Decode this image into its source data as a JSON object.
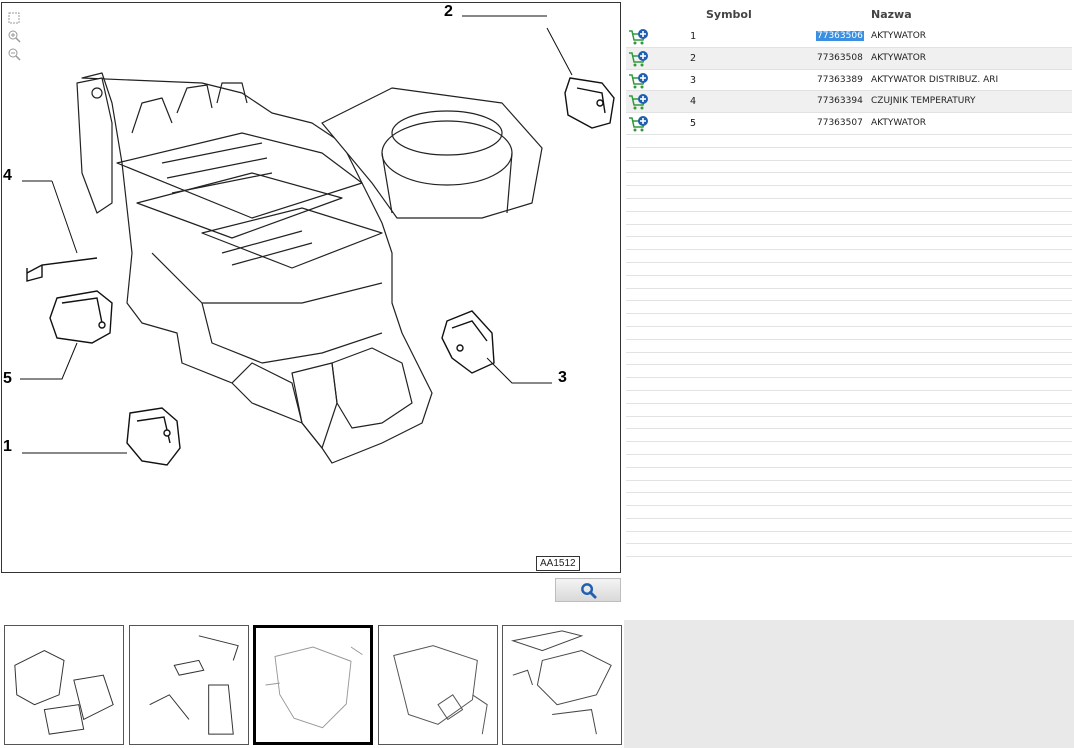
{
  "viewer": {
    "tools": [
      {
        "name": "fit-icon"
      },
      {
        "name": "zoom-in-icon"
      },
      {
        "name": "zoom-out-icon"
      }
    ],
    "callouts": [
      "1",
      "2",
      "3",
      "4",
      "5"
    ],
    "reference_code": "AA1512"
  },
  "search_button": {
    "icon": "search-icon"
  },
  "table": {
    "headers": {
      "symbol": "Symbol",
      "name": "Nazwa"
    },
    "rows": [
      {
        "symbol": "1",
        "number": "77363506",
        "name": "AKTYWATOR",
        "selected": true
      },
      {
        "symbol": "2",
        "number": "77363508",
        "name": "AKTYWATOR",
        "selected": false
      },
      {
        "symbol": "3",
        "number": "77363389",
        "name": "AKTYWATOR DISTRIBUZ. ARI",
        "selected": false
      },
      {
        "symbol": "4",
        "number": "77363394",
        "name": "CZUJNIK TEMPERATURY",
        "selected": false
      },
      {
        "symbol": "5",
        "number": "77363507",
        "name": "AKTYWATOR",
        "selected": false
      }
    ],
    "cart_icon": "add-to-cart-icon",
    "colors": {
      "selection": "#3b8fe0",
      "cart_green": "#2e9a3a",
      "cart_blue": "#1f5fb0"
    }
  },
  "thumbnails": {
    "count": 5,
    "active_index": 2
  }
}
